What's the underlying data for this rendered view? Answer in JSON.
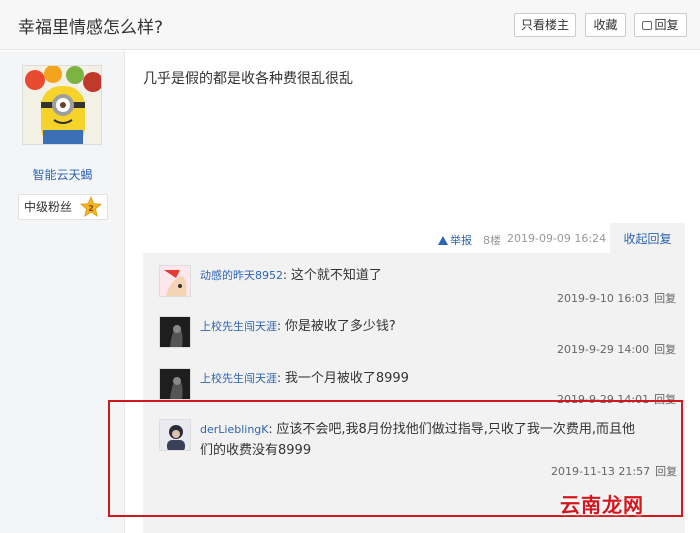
{
  "header": {
    "title": "幸福里情感怎么样?",
    "only_op_label": "只看楼主",
    "favorite_label": "收藏",
    "reply_label": "回复"
  },
  "author": {
    "name": "智能云天蝎",
    "level_label": "中级粉丝",
    "level_number": "2"
  },
  "post": {
    "content": "几乎是假的都是收各种费很乱很乱",
    "report_label": "举报",
    "floor": "8楼",
    "time": "2019-09-09 16:24",
    "collapse_label": "收起回复"
  },
  "replies": [
    {
      "name": "动感的昨天8952",
      "text": "这个就不知道了",
      "time": "2019-9-10 16:03",
      "reply_label": "回复"
    },
    {
      "name": "上校先生闯天涯",
      "text": "你是被收了多少钱?",
      "time": "2019-9-29 14:00",
      "reply_label": "回复"
    },
    {
      "name": "上校先生闯天涯",
      "text": "我一个月被收了8999",
      "time": "2019-9-29 14:01",
      "reply_label": "回复"
    },
    {
      "name": "derLieblingK",
      "text_line1": "应该不会吧,我8月份找他们做过指导,只收了我一次费用,而且他",
      "text_line2": "们的收费没有8999",
      "time": "2019-11-13 21:57",
      "reply_label": "回复"
    }
  ],
  "watermark": "云南龙网",
  "colors": {
    "link": "#2d64b3",
    "highlight_border": "#d0191d",
    "watermark": "#d2161b"
  }
}
